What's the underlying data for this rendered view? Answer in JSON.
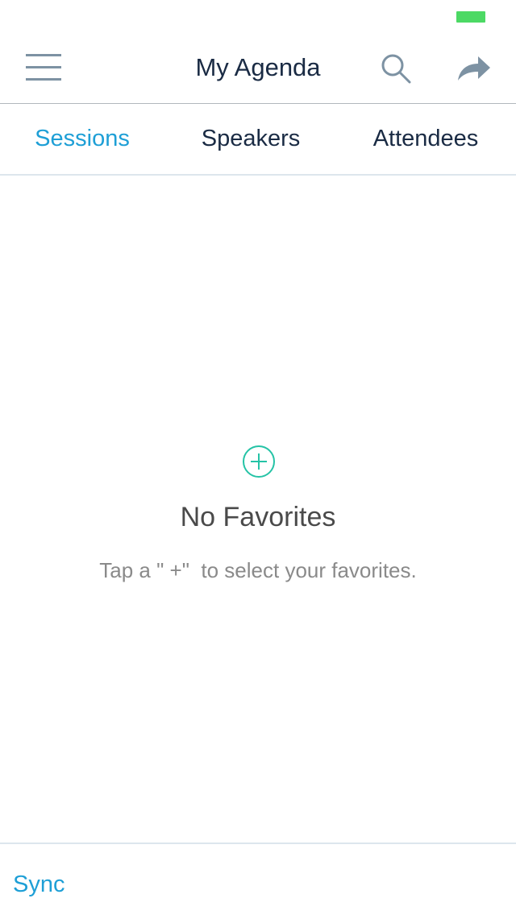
{
  "nav": {
    "title": "My Agenda",
    "icons": {
      "menu": "hamburger-menu-icon",
      "search": "search-icon",
      "share": "share-icon"
    }
  },
  "tabs": [
    {
      "label": "Sessions",
      "active": true
    },
    {
      "label": "Speakers",
      "active": false
    },
    {
      "label": "Attendees",
      "active": false
    }
  ],
  "empty_state": {
    "icon": "plus-circle-icon",
    "title": "No Favorites",
    "subtitle": "Tap a \" +\"  to select your favorites."
  },
  "footer": {
    "sync_label": "Sync"
  },
  "colors": {
    "accent": "#1e9fd6",
    "icon_gray": "#7d92a3",
    "title_navy": "#1a2b44",
    "plus_teal": "#25c3a6",
    "battery_green": "#4cd964"
  }
}
